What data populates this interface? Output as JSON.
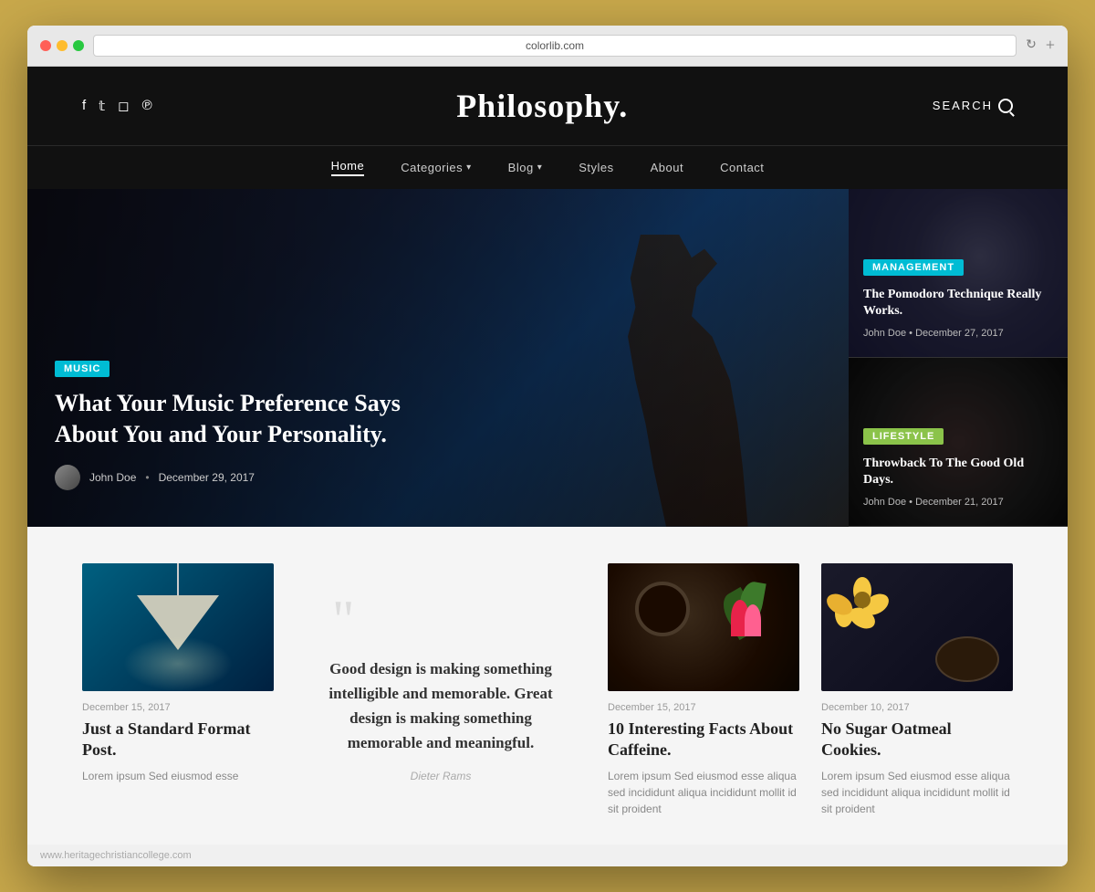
{
  "browser": {
    "url": "colorlib.com",
    "dots": [
      "red",
      "yellow",
      "green"
    ]
  },
  "header": {
    "title": "Philosophy.",
    "search_label": "SEARCH",
    "social": [
      "f",
      "𝕋",
      "⌂",
      "℗"
    ]
  },
  "nav": {
    "items": [
      {
        "label": "Home",
        "active": true,
        "has_arrow": false
      },
      {
        "label": "Categories",
        "active": false,
        "has_arrow": true
      },
      {
        "label": "Blog",
        "active": false,
        "has_arrow": true
      },
      {
        "label": "Styles",
        "active": false,
        "has_arrow": false
      },
      {
        "label": "About",
        "active": false,
        "has_arrow": false
      },
      {
        "label": "Contact",
        "active": false,
        "has_arrow": false
      }
    ]
  },
  "hero": {
    "tag": "MUSIC",
    "title": "What Your Music Preference Says About You and Your Personality.",
    "author": "John Doe",
    "date": "December 29, 2017"
  },
  "sidebar_posts": [
    {
      "tag": "MANAGEMENT",
      "title": "The Pomodoro Technique Really Works.",
      "author": "John Doe",
      "date": "December 27, 2017"
    },
    {
      "tag": "LIFESTYLE",
      "title": "Throwback To The Good Old Days.",
      "author": "John Doe",
      "date": "December 21, 2017"
    }
  ],
  "cards": [
    {
      "type": "image-post",
      "date": "December 15, 2017",
      "title": "Just a Standard Format Post.",
      "excerpt": "Lorem ipsum Sed eiusmod esse"
    },
    {
      "type": "quote",
      "text": "Good design is making something intelligible and memorable. Great design is making something memorable and meaningful.",
      "author": "Dieter Rams"
    },
    {
      "type": "photo-post",
      "date": "December 15, 2017",
      "title": "10 Interesting Facts About Caffeine.",
      "excerpt": "Lorem ipsum Sed eiusmod esse aliqua sed incididunt aliqua incididunt mollit id sit proident"
    },
    {
      "type": "photo-post",
      "date": "December 10, 2017",
      "title": "No Sugar Oatmeal Cookies.",
      "excerpt": "Lorem ipsum Sed eiusmod esse aliqua sed incididunt aliqua incididunt mollit id sit proident"
    }
  ],
  "footer": {
    "url": "www.heritagechristiancollege.com"
  },
  "colors": {
    "accent_cyan": "#00bcd4",
    "accent_green": "#8bc34a",
    "bg_dark": "#111111",
    "bg_light": "#f5f5f5",
    "brand_gold": "#c8a84b"
  }
}
